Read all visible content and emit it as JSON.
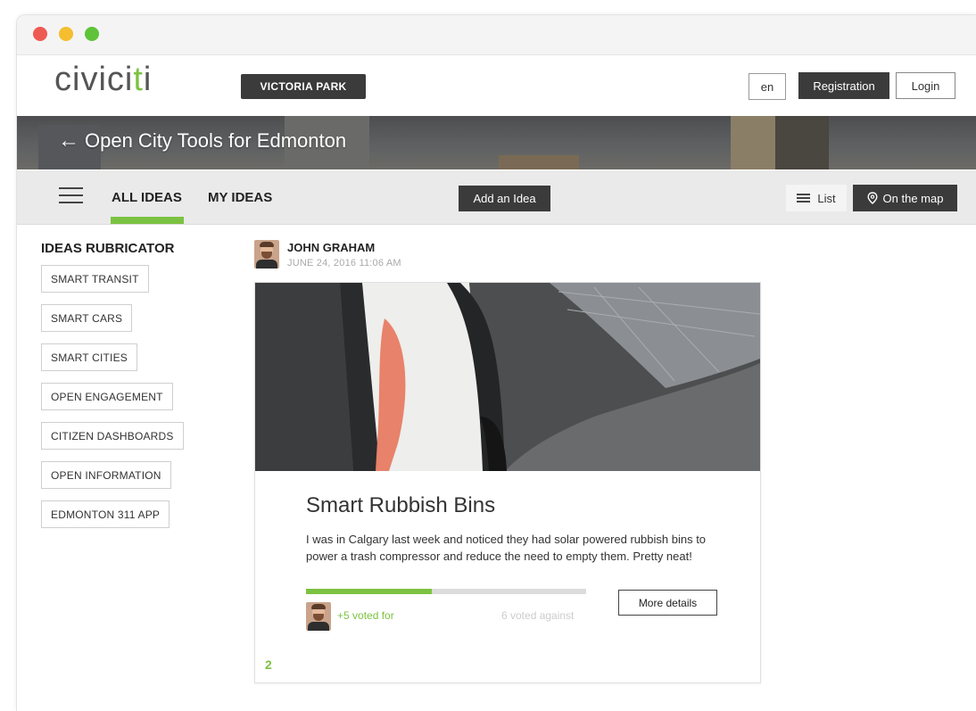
{
  "header": {
    "logo_prefix": "civici",
    "logo_accent": "t",
    "logo_suffix": "i",
    "district_label": "VICTORIA PARK",
    "lang_label": "en",
    "registration_label": "Registration",
    "login_label": "Login"
  },
  "banner": {
    "back_arrow": "←",
    "title": "Open City Tools for Edmonton"
  },
  "nav": {
    "tabs": [
      {
        "label": "ALL IDEAS",
        "active": true
      },
      {
        "label": "MY IDEAS",
        "active": false
      }
    ],
    "add_idea_label": "Add an Idea",
    "list_label": "List",
    "map_label": "On the map"
  },
  "rubricator": {
    "title": "IDEAS RUBRICATOR",
    "items": [
      "SMART TRANSIT",
      "SMART CARS",
      "SMART CITIES",
      "OPEN ENGAGEMENT",
      "CITIZEN DASHBOARDS",
      "OPEN INFORMATION",
      "EDMONTON 311 APP"
    ]
  },
  "idea": {
    "author": "JOHN GRAHAM",
    "date": "JUNE 24, 2016 11:06 AM",
    "title": "Smart Rubbish Bins",
    "description": "I was in Calgary last week and noticed they had solar powered rubbish bins to power a trash compressor and reduce the need to empty them. Pretty neat!",
    "votes_for": "+5 voted for",
    "votes_against": "6 voted against",
    "vote_progress_percent": 45,
    "more_details_label": "More details",
    "comment_count": "2"
  },
  "colors": {
    "accent": "#7cc242",
    "dark_button": "#3b3b3b"
  }
}
